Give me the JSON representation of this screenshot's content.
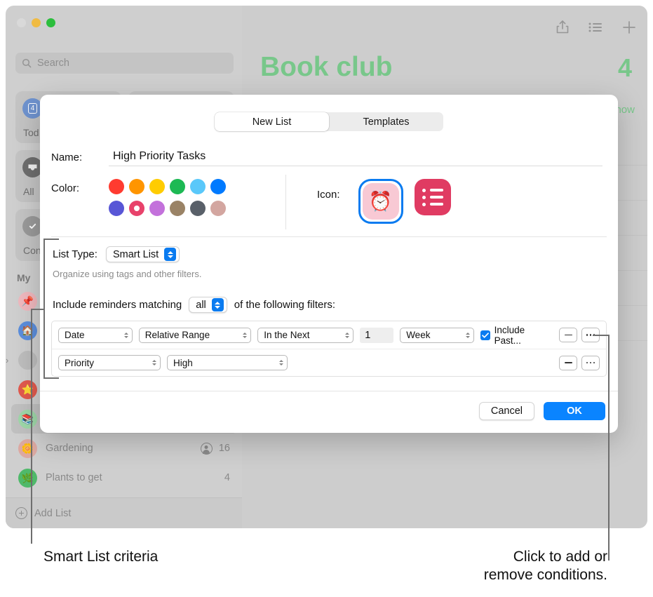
{
  "background_app": {
    "search": {
      "placeholder": "Search",
      "icon": "search-icon"
    },
    "window_controls": [
      "close-button",
      "minimize-button",
      "zoom-button"
    ],
    "toolbar_icons": [
      "share-icon",
      "list-view-icon",
      "add-reminder-icon"
    ],
    "smart_cards": [
      {
        "label": "Tod",
        "count": "4",
        "icon": "calendar-icon"
      },
      {
        "label": "",
        "count": "",
        "icon": "scheduled-icon"
      },
      {
        "label": "All",
        "count": "",
        "icon": "inbox-icon"
      },
      {
        "label": "",
        "count": "",
        "icon": "flag-icon"
      },
      {
        "label": "Con",
        "count": "",
        "icon": "completed-check-icon"
      }
    ],
    "my_lists_header": "My",
    "lists": [
      {
        "name": "",
        "emoji": "📌",
        "count": "",
        "shared": false
      },
      {
        "name": "",
        "emoji": "🏠",
        "count": "",
        "shared": false
      },
      {
        "name": "",
        "emoji": "",
        "count": "",
        "shared": false,
        "group": true
      },
      {
        "name": "",
        "emoji": "⭐",
        "count": "",
        "shared": false
      },
      {
        "name": "",
        "emoji": "📚",
        "count": "",
        "shared": false,
        "selected": true
      },
      {
        "name": "Gardening",
        "emoji": "🌼",
        "count": "16",
        "shared": true
      },
      {
        "name": "Plants to get",
        "emoji": "🌿",
        "count": "4",
        "shared": false
      }
    ],
    "add_list_label": "Add List",
    "main": {
      "title": "Book club",
      "count": "4",
      "show_link": "how",
      "title_color": "#78c78a"
    }
  },
  "dialog": {
    "segments": [
      {
        "label": "New List",
        "active": true
      },
      {
        "label": "Templates",
        "active": false
      }
    ],
    "name_label": "Name:",
    "name_value": "High Priority Tasks",
    "color_label": "Color:",
    "colors": [
      {
        "hex": "#ff3b30",
        "name": "red",
        "selected": false
      },
      {
        "hex": "#ff9500",
        "name": "orange",
        "selected": false
      },
      {
        "hex": "#ffcc00",
        "name": "yellow",
        "selected": false
      },
      {
        "hex": "#1db954",
        "name": "green",
        "selected": false
      },
      {
        "hex": "#5ac8fa",
        "name": "light-blue",
        "selected": false
      },
      {
        "hex": "#007aff",
        "name": "blue",
        "selected": false
      },
      {
        "hex": "#5856d6",
        "name": "indigo",
        "selected": false
      },
      {
        "hex": "#e8426b",
        "name": "pink",
        "selected": true
      },
      {
        "hex": "#c371db",
        "name": "violet",
        "selected": false
      },
      {
        "hex": "#9a8366",
        "name": "brown",
        "selected": false
      },
      {
        "hex": "#596069",
        "name": "gray",
        "selected": false
      },
      {
        "hex": "#d3a6a0",
        "name": "dusty-rose",
        "selected": false
      }
    ],
    "icon_label": "Icon:",
    "icons": [
      {
        "glyph": "⏰",
        "name": "alarm-clock-icon",
        "selected": true
      },
      {
        "glyph": "",
        "name": "list-bullets-icon",
        "selected": false
      }
    ],
    "list_type_label": "List Type:",
    "list_type_value": "Smart List",
    "list_type_hint": "Organize using tags and other filters.",
    "match_prefix": "Include reminders matching",
    "match_value": "all",
    "match_suffix": "of the following filters:",
    "filters": [
      {
        "field": "Date",
        "operator": "Relative Range",
        "condition": "In the Next",
        "amount": "1",
        "unit": "Week",
        "checkbox_label": "Include Past...",
        "checkbox_checked": true,
        "remove_label": "remove-condition",
        "more_label": "more-options"
      },
      {
        "field": "Priority",
        "operator": "High",
        "condition": null,
        "amount": null,
        "unit": null,
        "checkbox_label": null,
        "checkbox_checked": false,
        "remove_label": "remove-condition",
        "more_label": "more-options"
      }
    ],
    "cancel_label": "Cancel",
    "ok_label": "OK",
    "accent_color": "#0a84ff"
  },
  "callouts": {
    "left": "Smart List criteria",
    "right_line1": "Click to add or",
    "right_line2": "remove conditions."
  }
}
